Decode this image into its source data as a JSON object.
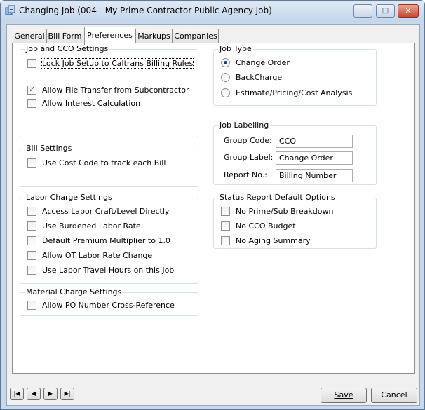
{
  "window": {
    "title": "Changing Job  (004 - My Prime Contractor Public Agency Job)",
    "minimize": "–",
    "maximize": "□",
    "close": "✕"
  },
  "tabs": [
    "General",
    "Bill Form",
    "Preferences",
    "Markups",
    "Companies"
  ],
  "active_tab": "Preferences",
  "job_cco": {
    "title": "Job and CCO Settings",
    "items": [
      {
        "label": "Lock Job Setup to Caltrans Billing Rules",
        "checked": false
      },
      {
        "label": "Allow File Transfer from Subcontractor",
        "checked": true
      },
      {
        "label": "Allow Interest Calculation",
        "checked": false
      }
    ]
  },
  "bill_settings": {
    "title": "Bill Settings",
    "items": [
      {
        "label": "Use Cost Code to track each Bill",
        "checked": false
      }
    ]
  },
  "labor": {
    "title": "Labor Charge Settings",
    "items": [
      {
        "label": "Access Labor Craft/Level Directly",
        "checked": false
      },
      {
        "label": "Use Burdened Labor Rate",
        "checked": false
      },
      {
        "label": "Default Premium Multiplier to 1.0",
        "checked": false
      },
      {
        "label": "Allow OT Labor Rate Change",
        "checked": false
      },
      {
        "label": "Use Labor Travel Hours on this Job",
        "checked": false
      }
    ]
  },
  "material": {
    "title": "Material Charge Settings",
    "items": [
      {
        "label": "Allow PO Number Cross-Reference",
        "checked": false
      }
    ]
  },
  "job_type": {
    "title": "Job Type",
    "options": [
      {
        "label": "Change Order",
        "selected": true
      },
      {
        "label": "BackCharge",
        "selected": false
      },
      {
        "label": "Estimate/Pricing/Cost Analysis",
        "selected": false
      }
    ]
  },
  "labelling": {
    "title": "Job Labelling",
    "group_code_label": "Group Code:",
    "group_code_value": "CCO",
    "group_label_label": "Group Label:",
    "group_label_value": "Change Order",
    "report_no_label": "Report No.:",
    "report_no_value": "Billing Number"
  },
  "status_report": {
    "title": "Status Report Default Options",
    "items": [
      {
        "label": "No Prime/Sub Breakdown",
        "checked": false
      },
      {
        "label": "No CCO Budget",
        "checked": false
      },
      {
        "label": "No Aging Summary",
        "checked": false
      }
    ]
  },
  "nav": {
    "first": "|◀",
    "prev": "◀",
    "next": "▶",
    "last": "▶|"
  },
  "buttons": {
    "save": "Save",
    "cancel": "Cancel"
  }
}
